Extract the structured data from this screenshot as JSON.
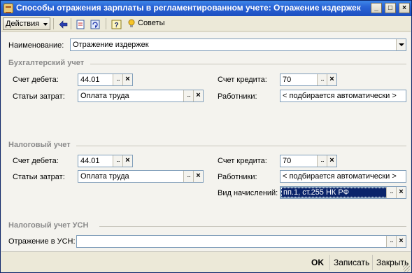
{
  "window": {
    "title": "Способы отражения зарплаты в регламентированном учете: Отражение издержек",
    "controls": {
      "minimize": "_",
      "maximize": "□",
      "close": "×"
    }
  },
  "toolbar": {
    "actions_label": "Действия",
    "icons": [
      "back-arrow-icon",
      "document-icon",
      "refresh-icon",
      "help-icon"
    ],
    "help_glyph": "?",
    "tips_label": "Советы"
  },
  "form": {
    "name_label": "Наименование:",
    "name_value": "Отражение издержек",
    "accounting": {
      "section_title": "Бухгалтерский учет",
      "debit_label": "Счет дебета:",
      "debit_value": "44.01",
      "credit_label": "Счет кредита:",
      "credit_value": "70",
      "cost_label": "Статьи затрат:",
      "cost_value": "Оплата труда",
      "workers_label": "Работники:",
      "workers_value": "< подбирается автоматически >"
    },
    "tax": {
      "section_title": "Налоговый учет",
      "debit_label": "Счет дебета:",
      "debit_value": "44.01",
      "credit_label": "Счет кредита:",
      "credit_value": "70",
      "cost_label": "Статьи затрат:",
      "cost_value": "Оплата труда",
      "workers_label": "Работники:",
      "workers_value": "< подбирается автоматически >",
      "accrual_label": "Вид начислений:",
      "accrual_value": "пп.1, ст.255 НК РФ"
    },
    "usn": {
      "section_title": "Налоговый учет УСН",
      "reflection_label": "Отражение в УСН:",
      "reflection_value": ""
    },
    "select_glyph": "...",
    "clear_glyph": "×"
  },
  "footer": {
    "ok_label": "OK",
    "save_label": "Записать",
    "close_label": "Закрыть"
  },
  "colors": {
    "titlebar": "#2a64d6",
    "selection": "#0a246a",
    "field_border": "#7f9db9",
    "section_text": "#8a8a8a"
  }
}
